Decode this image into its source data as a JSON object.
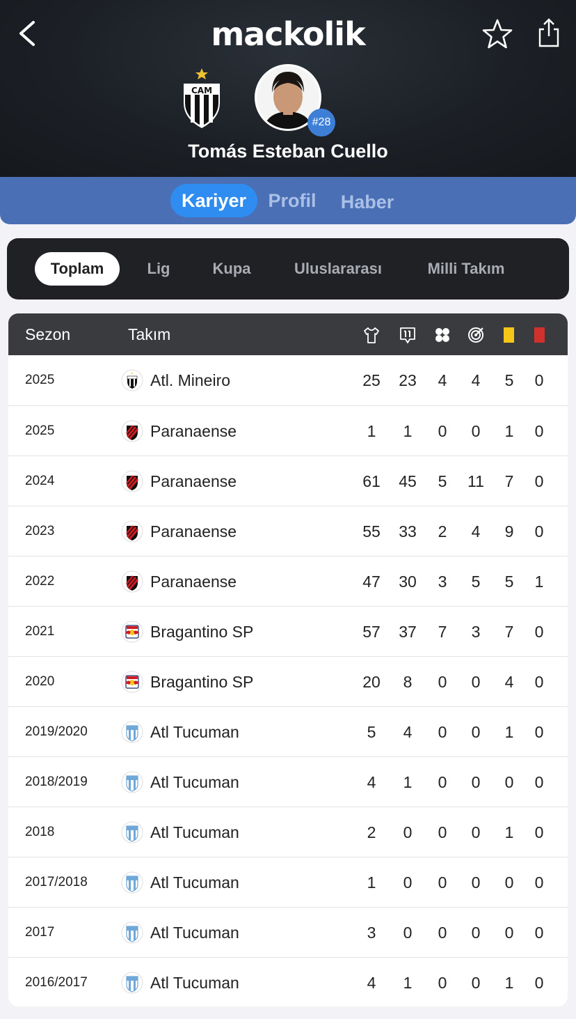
{
  "app": {
    "logo": "mackolik"
  },
  "icons": {
    "back": "chevron-left-icon",
    "favorite": "star-outline-icon",
    "share": "share-icon",
    "appearances": "jersey-icon",
    "starts": "lineup-eleven-icon",
    "goals": "football-icon",
    "assists": "target-icon",
    "yellow": "yellow-card-icon",
    "red": "red-card-icon"
  },
  "player": {
    "name": "Tomás Esteban Cuello",
    "number": "#28",
    "club_crest": "CAM"
  },
  "tabs": [
    {
      "label": "Kariyer",
      "active": true
    },
    {
      "label": "Profil",
      "active": false
    },
    {
      "label": "Haber",
      "active": false
    }
  ],
  "filters": [
    {
      "label": "Toplam",
      "active": true
    },
    {
      "label": "Lig",
      "active": false
    },
    {
      "label": "Kupa",
      "active": false
    },
    {
      "label": "Uluslararası",
      "active": false
    },
    {
      "label": "Milli Takım",
      "active": false
    }
  ],
  "table": {
    "headers": {
      "season": "Sezon",
      "team": "Takım"
    },
    "rows": [
      {
        "season": "2025",
        "team": "Atl. Mineiro",
        "crest": "mineiro",
        "stats": [
          "25",
          "23",
          "4",
          "4",
          "5",
          "0"
        ]
      },
      {
        "season": "2025",
        "team": "Paranaense",
        "crest": "paranaense",
        "stats": [
          "1",
          "1",
          "0",
          "0",
          "1",
          "0"
        ]
      },
      {
        "season": "2024",
        "team": "Paranaense",
        "crest": "paranaense",
        "stats": [
          "61",
          "45",
          "5",
          "11",
          "7",
          "0"
        ]
      },
      {
        "season": "2023",
        "team": "Paranaense",
        "crest": "paranaense",
        "stats": [
          "55",
          "33",
          "2",
          "4",
          "9",
          "0"
        ]
      },
      {
        "season": "2022",
        "team": "Paranaense",
        "crest": "paranaense",
        "stats": [
          "47",
          "30",
          "3",
          "5",
          "5",
          "1"
        ]
      },
      {
        "season": "2021",
        "team": "Bragantino SP",
        "crest": "bragantino",
        "stats": [
          "57",
          "37",
          "7",
          "3",
          "7",
          "0"
        ]
      },
      {
        "season": "2020",
        "team": "Bragantino SP",
        "crest": "bragantino",
        "stats": [
          "20",
          "8",
          "0",
          "0",
          "4",
          "0"
        ]
      },
      {
        "season": "2019/2020",
        "team": "Atl Tucuman",
        "crest": "tucuman",
        "stats": [
          "5",
          "4",
          "0",
          "0",
          "1",
          "0"
        ]
      },
      {
        "season": "2018/2019",
        "team": "Atl Tucuman",
        "crest": "tucuman",
        "stats": [
          "4",
          "1",
          "0",
          "0",
          "0",
          "0"
        ]
      },
      {
        "season": "2018",
        "team": "Atl Tucuman",
        "crest": "tucuman",
        "stats": [
          "2",
          "0",
          "0",
          "0",
          "1",
          "0"
        ]
      },
      {
        "season": "2017/2018",
        "team": "Atl Tucuman",
        "crest": "tucuman",
        "stats": [
          "1",
          "0",
          "0",
          "0",
          "0",
          "0"
        ]
      },
      {
        "season": "2017",
        "team": "Atl Tucuman",
        "crest": "tucuman",
        "stats": [
          "3",
          "0",
          "0",
          "0",
          "0",
          "0"
        ]
      },
      {
        "season": "2016/2017",
        "team": "Atl Tucuman",
        "crest": "tucuman",
        "stats": [
          "4",
          "1",
          "0",
          "0",
          "1",
          "0"
        ]
      }
    ]
  },
  "colors": {
    "tabbar": "#4a6fb5",
    "active_tab": "#2f8cf0",
    "yellow_card": "#f5c518",
    "red_card": "#d0312d"
  }
}
